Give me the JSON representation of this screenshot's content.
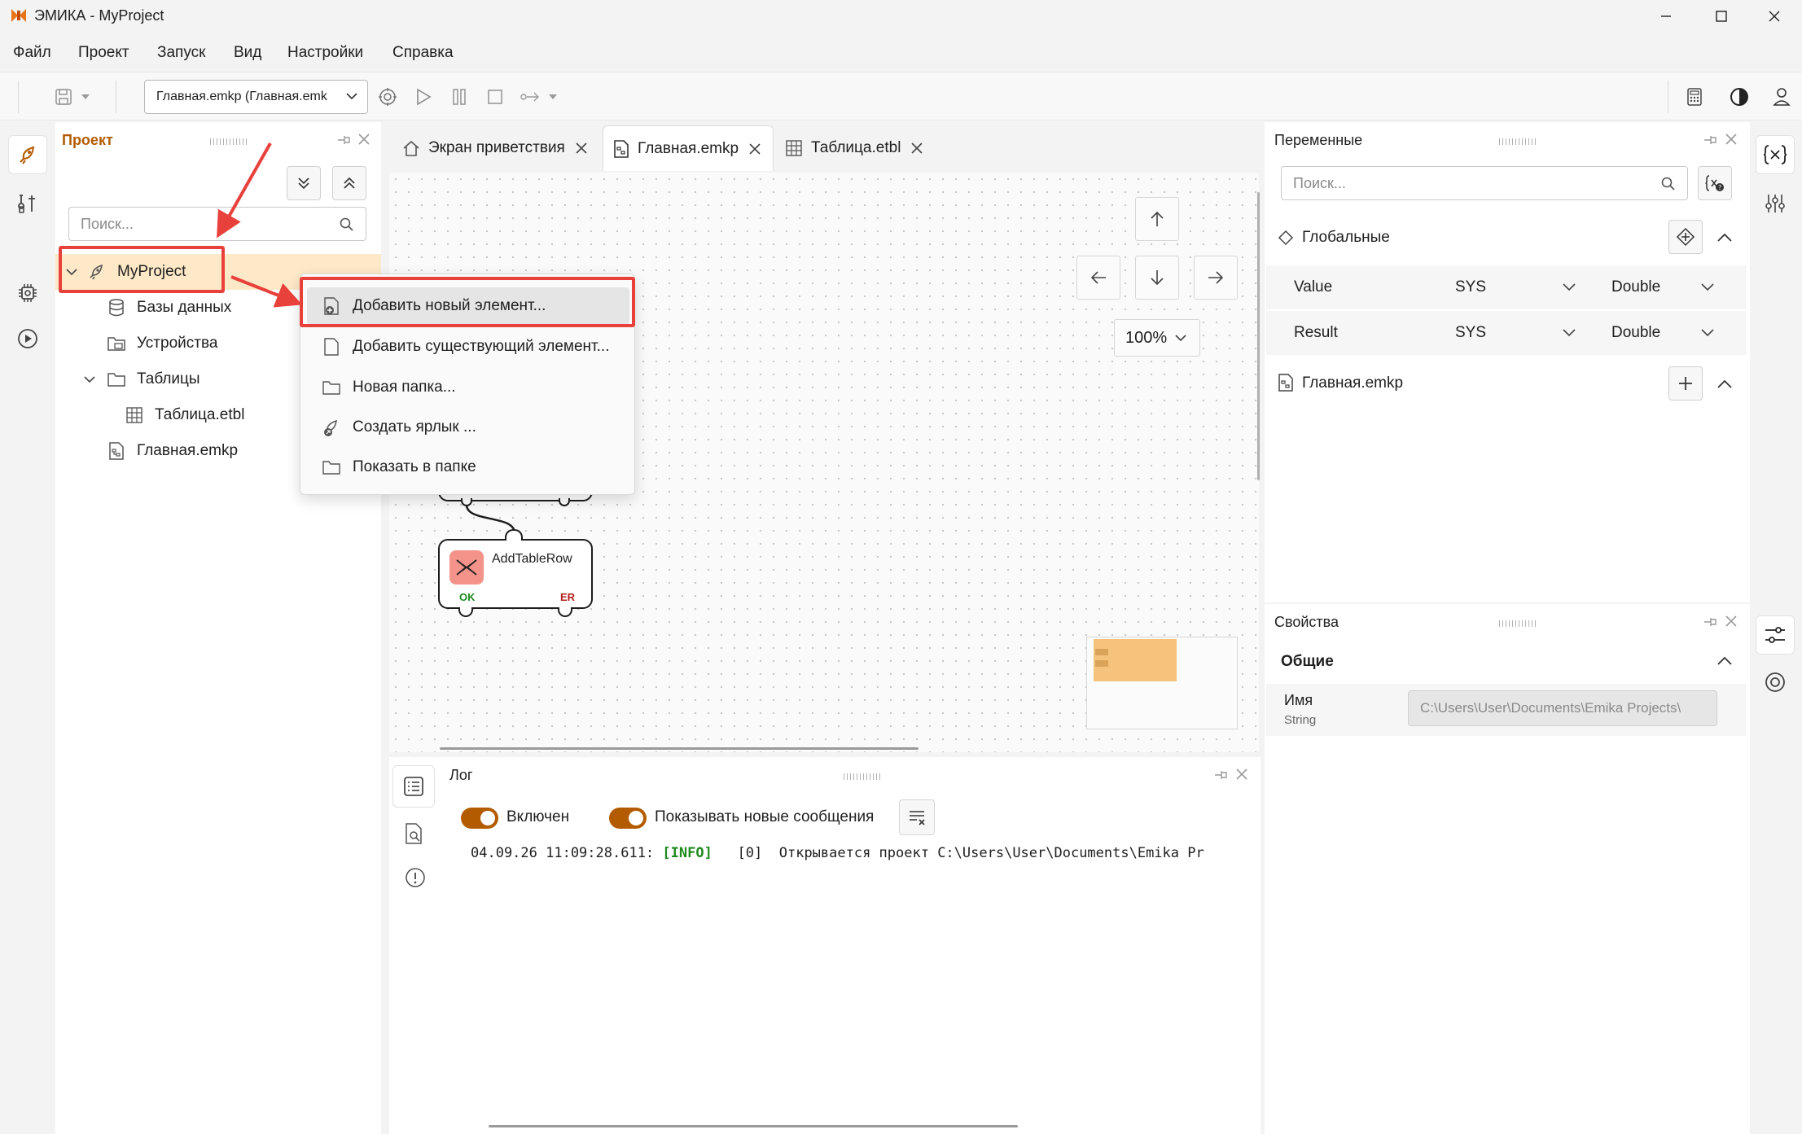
{
  "window": {
    "title": "ЭМИКА - MyProject"
  },
  "menu": [
    "Файл",
    "Проект",
    "Запуск",
    "Вид",
    "Настройки",
    "Справка"
  ],
  "toolbar": {
    "file_combo": "Главная.emkp (Главная.emk"
  },
  "project_panel": {
    "title": "Проект",
    "search_placeholder": "Поиск...",
    "tree": {
      "root": "MyProject",
      "databases": "Базы данных",
      "devices": "Устройства",
      "tables": "Таблицы",
      "table_file": "Таблица.etbl",
      "main_file": "Главная.emkp"
    }
  },
  "tabs": [
    "Экран приветствия",
    "Главная.emkp",
    "Таблица.etbl"
  ],
  "canvas": {
    "zoom": "100%",
    "node": {
      "label": "AddTableRow",
      "ok": "OK",
      "er": "ER"
    }
  },
  "context_menu": [
    "Добавить новый элемент...",
    "Добавить существующий элемент...",
    "Новая папка...",
    "Создать ярлык ...",
    "Показать в папке"
  ],
  "log": {
    "title": "Лог",
    "toggle_enabled": "Включен",
    "toggle_new": "Показывать новые сообщения",
    "line": {
      "timestamp": "04.09.26 11:09:28.611:",
      "level": "[INFO]",
      "message": "[0]  Открывается проект C:\\Users\\User\\Documents\\Emika Pr"
    }
  },
  "variables": {
    "title": "Переменные",
    "search_placeholder": "Поиск...",
    "global_section": "Глобальные",
    "rows": [
      {
        "name": "Value",
        "scope": "SYS",
        "type": "Double"
      },
      {
        "name": "Result",
        "scope": "SYS",
        "type": "Double"
      }
    ],
    "file_section": "Главная.emkp"
  },
  "properties": {
    "title": "Свойства",
    "section": "Общие",
    "name_label": "Имя",
    "name_type": "String",
    "name_value": "C:\\Users\\User\\Documents\\Emika Projects\\"
  },
  "colors": {
    "accent": "#b35b00",
    "callout": "#e8403a",
    "selection": "#fde9c7",
    "info": "#1e8a1e"
  }
}
